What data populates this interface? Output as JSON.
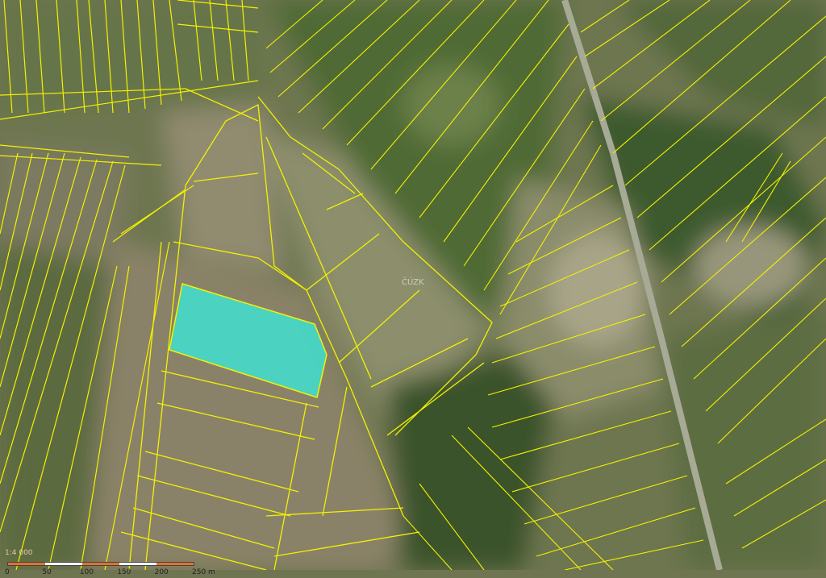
{
  "map": {
    "type": "cadastral-orthophoto",
    "colors": {
      "parcel_line": "#f2f200",
      "highlight_fill": "#40e0d0",
      "road": "#a7aa95",
      "field_light": "#8e8a6f",
      "forest_dark": "#3f5a2e"
    },
    "highlighted_parcel": "selected-parcel"
  },
  "scale": {
    "ratio": "1:4 000",
    "labels": [
      "0",
      "50",
      "100",
      "150",
      "200",
      "250 m"
    ],
    "segment_colors": [
      "#e3722b",
      "#ffffff",
      "#e3722b",
      "#ffffff",
      "#e3722b"
    ]
  },
  "watermark": "ČÚZK"
}
